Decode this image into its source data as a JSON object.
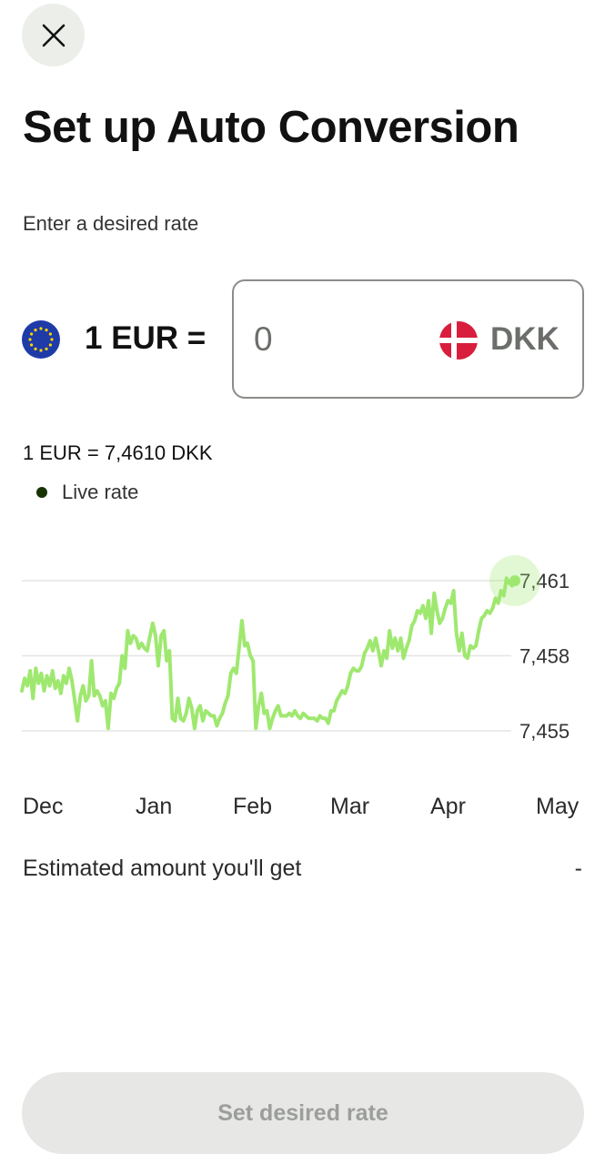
{
  "header": {
    "title": "Set up Auto Conversion",
    "close_icon": "close-icon"
  },
  "form": {
    "subtitle": "Enter a desired rate",
    "base_amount": "1 EUR =",
    "base_flag_icon": "eu-flag-icon",
    "rate_input_value": "0",
    "quote_currency": "DKK",
    "quote_flag_icon": "denmark-flag-icon"
  },
  "live": {
    "rate_text": "1 EUR = 7,4610 DKK",
    "label": "Live rate",
    "dot_color": "#163300"
  },
  "chart_data": {
    "type": "line",
    "series_color": "#9fe870",
    "x_ticks": [
      "Dec",
      "Jan",
      "Feb",
      "Mar",
      "Apr",
      "May"
    ],
    "y_ticks": [
      7.455,
      7.458,
      7.461
    ],
    "y_tick_labels": [
      "7,455",
      "7,458",
      "7,461"
    ],
    "ylim": [
      7.455,
      7.461
    ],
    "grid": true,
    "y": [
      7.4566,
      7.4571,
      7.4568,
      7.4574,
      7.4563,
      7.4575,
      7.4569,
      7.4573,
      7.4566,
      7.4572,
      7.4568,
      7.4574,
      7.4567,
      7.457,
      7.4565,
      7.4572,
      7.4569,
      7.4575,
      7.457,
      7.4562,
      7.4554,
      7.4564,
      7.4568,
      7.4562,
      7.4564,
      7.4578,
      7.4564,
      7.4566,
      7.4564,
      7.456,
      7.4562,
      7.4551,
      7.4565,
      7.4563,
      7.4567,
      7.4569,
      7.458,
      7.4575,
      7.459,
      7.4585,
      7.4588,
      7.4587,
      7.4583,
      7.4585,
      7.4583,
      7.4582,
      7.4588,
      7.4593,
      7.4588,
      7.4576,
      7.4588,
      7.459,
      7.4578,
      7.4582,
      7.4555,
      7.4554,
      7.4563,
      7.4555,
      7.4554,
      7.4557,
      7.4563,
      7.4559,
      7.4551,
      7.4558,
      7.456,
      7.4554,
      7.4558,
      7.4557,
      7.4556,
      7.4556,
      7.4552,
      7.4555,
      7.4557,
      7.4561,
      7.4564,
      7.4573,
      7.4575,
      7.4573,
      7.4583,
      7.4594,
      7.4584,
      7.4585,
      7.458,
      7.4578,
      7.4551,
      7.456,
      7.4565,
      7.4557,
      7.4558,
      7.4551,
      7.4555,
      7.4558,
      7.456,
      7.4556,
      7.4556,
      7.4556,
      7.4557,
      7.4556,
      7.4558,
      7.4556,
      7.4555,
      7.4557,
      7.4556,
      7.4555,
      7.4555,
      7.4555,
      7.4554,
      7.4556,
      7.4555,
      7.4555,
      7.4553,
      7.4558,
      7.4558,
      7.4562,
      7.4564,
      7.4566,
      7.4565,
      7.4568,
      7.4573,
      7.4575,
      7.4574,
      7.4574,
      7.4576,
      7.4581,
      7.4583,
      7.4586,
      7.4582,
      7.4587,
      7.4582,
      7.4576,
      7.4582,
      7.4579,
      7.459,
      7.4583,
      7.4587,
      7.4582,
      7.4587,
      7.4579,
      7.4583,
      7.4586,
      7.4592,
      7.4594,
      7.4598,
      7.4597,
      7.46,
      7.4595,
      7.4602,
      7.4589,
      7.4605,
      7.4598,
      7.4593,
      7.4595,
      7.4599,
      7.4602,
      7.4601,
      7.4606,
      7.4589,
      7.4582,
      7.4589,
      7.458,
      7.4579,
      7.4584,
      7.4583,
      7.4584,
      7.459,
      7.4595,
      7.4596,
      7.4598,
      7.4597,
      7.4599,
      7.4603,
      7.4601,
      7.4606,
      7.4604,
      7.4611,
      7.4609,
      7.4608,
      7.461
    ]
  },
  "estimate": {
    "label": "Estimated amount you'll get",
    "value": "-"
  },
  "footer": {
    "button_label": "Set desired rate"
  }
}
